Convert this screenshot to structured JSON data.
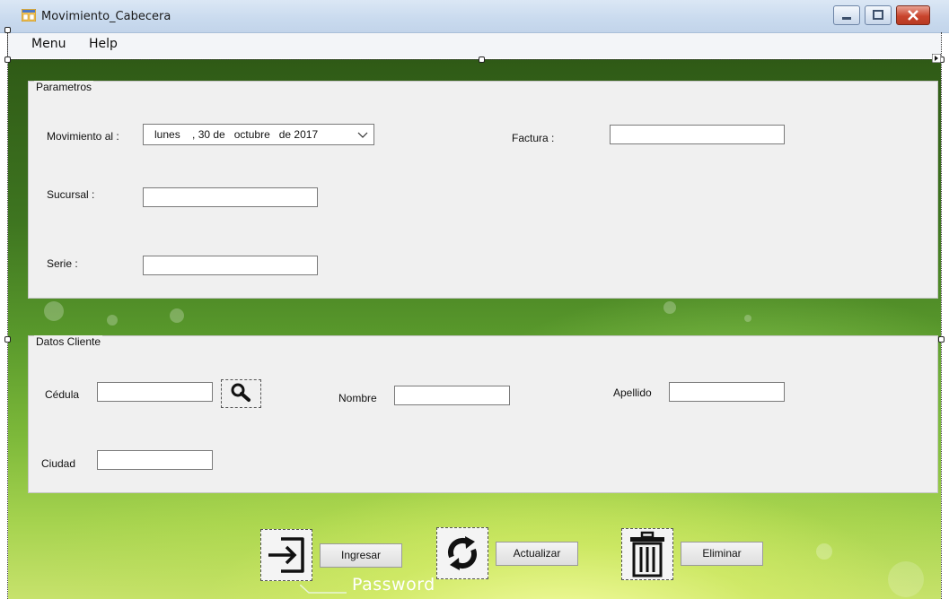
{
  "window": {
    "title": "Movimiento_Cabecera"
  },
  "menu": {
    "items": [
      "Menu",
      "Help"
    ]
  },
  "parametros": {
    "title": "Parametros",
    "movimiento_label": "Movimiento al :",
    "date_value": "lunes    , 30 de   octubre   de 2017",
    "factura_label": "Factura  :",
    "factura_value": "",
    "sucursal_label": "Sucursal :",
    "sucursal_value": "",
    "serie_label": "Serie :",
    "serie_value": ""
  },
  "cliente": {
    "title": "Datos Cliente",
    "cedula_label": "Cédula",
    "cedula_value": "",
    "nombre_label": "Nombre",
    "nombre_value": "",
    "apellido_label": "Apellido",
    "apellido_value": "",
    "ciudad_label": "Ciudad",
    "ciudad_value": ""
  },
  "actions": {
    "ingresar": "Ingresar",
    "actualizar": "Actualizar",
    "eliminar": "Eliminar"
  },
  "background_text": "Password",
  "icons": {
    "app": "form-icon",
    "search": "search-icon",
    "ingresar": "login-arrow-icon",
    "actualizar": "refresh-icon",
    "eliminar": "trash-icon"
  },
  "colors": {
    "title_bar": "#c9daee",
    "panel": "#f0f0f0",
    "close_button": "#c9452d"
  }
}
